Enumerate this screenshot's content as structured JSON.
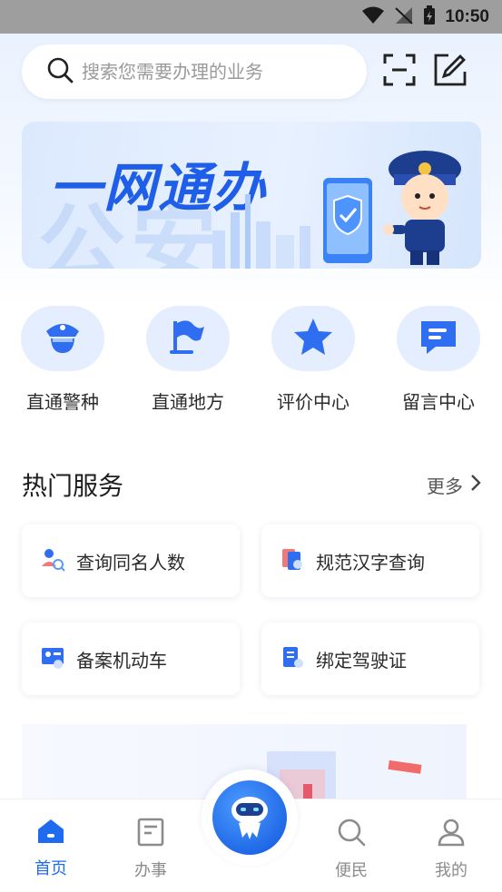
{
  "status_bar": {
    "time": "10:50"
  },
  "search": {
    "placeholder": "搜索您需要办理的业务"
  },
  "banner": {
    "headline": "一网通办",
    "bg_text": "公安"
  },
  "quick_actions": [
    {
      "label": "直通警种",
      "icon": "police-cap-icon"
    },
    {
      "label": "直通地方",
      "icon": "flag-icon"
    },
    {
      "label": "评价中心",
      "icon": "star-icon"
    },
    {
      "label": "留言中心",
      "icon": "message-icon"
    }
  ],
  "hot_services": {
    "title": "热门服务",
    "more_label": "更多",
    "items": [
      {
        "label": "查询同名人数",
        "icon": "people-search-icon"
      },
      {
        "label": "规范汉字查询",
        "icon": "character-book-icon"
      },
      {
        "label": "备案机动车",
        "icon": "vehicle-register-icon"
      },
      {
        "label": "绑定驾驶证",
        "icon": "license-icon"
      }
    ]
  },
  "tab_bar": {
    "tabs": [
      {
        "label": "首页",
        "icon": "home-icon",
        "active": true
      },
      {
        "label": "办事",
        "icon": "document-icon",
        "active": false
      },
      {
        "label": "便民",
        "icon": "search-icon",
        "active": false
      },
      {
        "label": "我的",
        "icon": "user-icon",
        "active": false
      }
    ],
    "center_icon": "robot-assistant-icon"
  },
  "colors": {
    "accent": "#1f6bf0",
    "icon_bg": "#e4eefe",
    "banner_text": "#1f5ee8"
  }
}
